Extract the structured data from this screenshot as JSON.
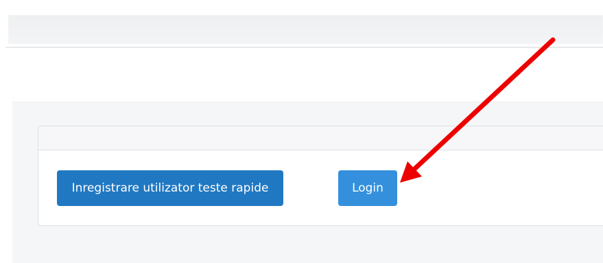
{
  "card": {
    "register_button_label": "Inregistrare utilizator teste rapide",
    "login_button_label": "Login"
  },
  "colors": {
    "register_button": "#2178c2",
    "login_button": "#3490dc",
    "annotation_arrow": "#ee0000"
  },
  "icons": {
    "annotation": "red-arrow-icon"
  }
}
